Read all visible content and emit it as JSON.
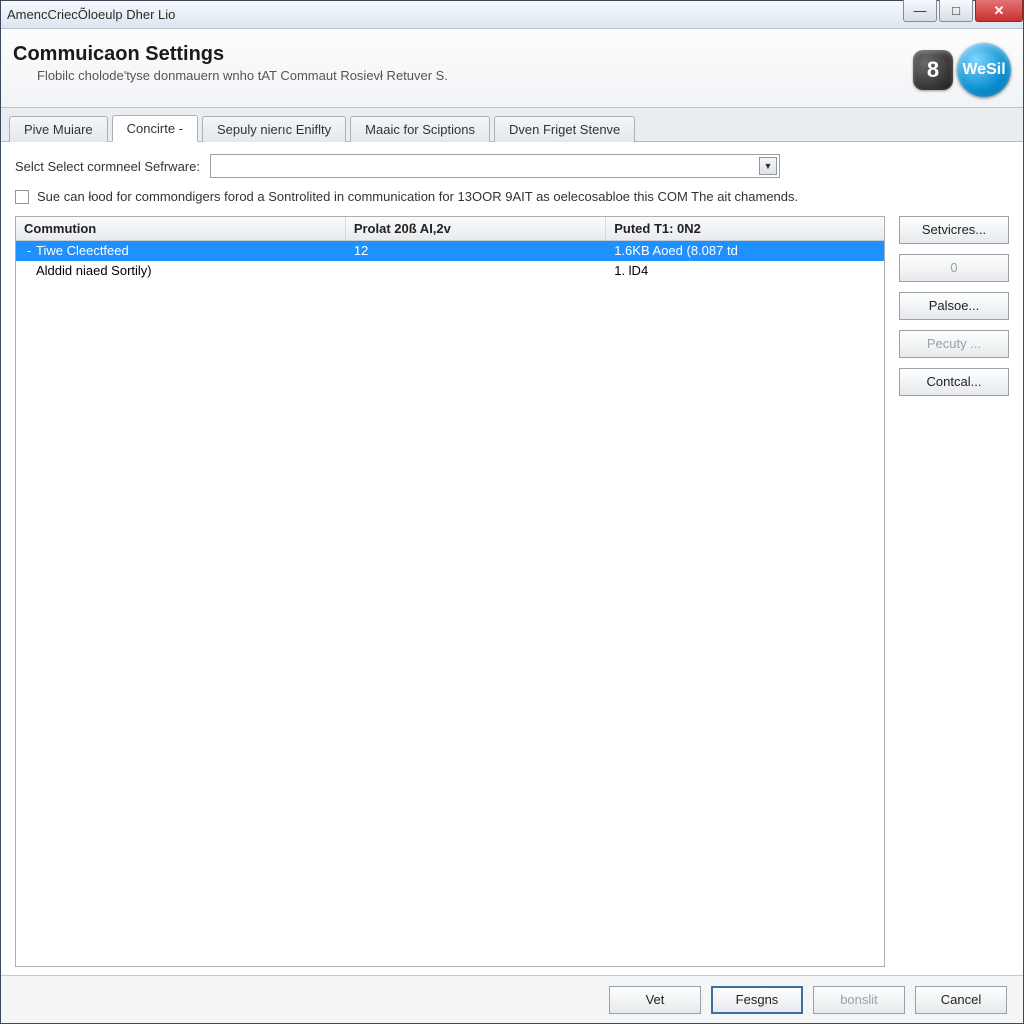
{
  "window": {
    "title": "AmencCriecÕloeulp Dher Lio"
  },
  "header": {
    "title": "Commuicaon Settings",
    "subtitle": "Flobilc cholode'tyse donmauern wnho tAT Commaut Rosievł Retuver S.",
    "badge8": "8",
    "badgeWs": "WeSil"
  },
  "tabs": [
    {
      "label": "Pive Muiare",
      "active": false
    },
    {
      "label": "Concirte -",
      "active": true
    },
    {
      "label": "Sepuly nierıc Eniflty",
      "active": false
    },
    {
      "label": "Maaic for Sciptions",
      "active": false
    },
    {
      "label": "Dven Friget Stenve",
      "active": false
    }
  ],
  "select": {
    "label": "Selct Select cormneel Sefrware:",
    "value": ""
  },
  "checkbox": {
    "checked": false,
    "text": "Sue can łood for commondigers forod a Sontrolited in communication for 13OOR 9AIT as oelecosabloe this COM The ait chamends."
  },
  "table": {
    "columns": [
      "Commution",
      "Prolat 20ß AI,2v",
      "Puted T1: 0N2"
    ],
    "rows": [
      {
        "c1": "Tiwe Cleectfeed",
        "c2": "12",
        "c3": "1.6KB Aoed (8.087 td",
        "selected": true,
        "expander": "-"
      },
      {
        "c1": "Alddid niaed Sortily)",
        "c2": "",
        "c3": "1. lD4",
        "selected": false,
        "expander": ""
      }
    ]
  },
  "side": {
    "services": "Setvicres...",
    "zero": "0",
    "pause": "Palsoe...",
    "pecuty": "Pecuty ...",
    "contcal": "Contcal..."
  },
  "footer": {
    "vet": "Vet",
    "fesgns": "Fesgns",
    "bonslit": "bonslit",
    "cancel": "Cancel"
  }
}
